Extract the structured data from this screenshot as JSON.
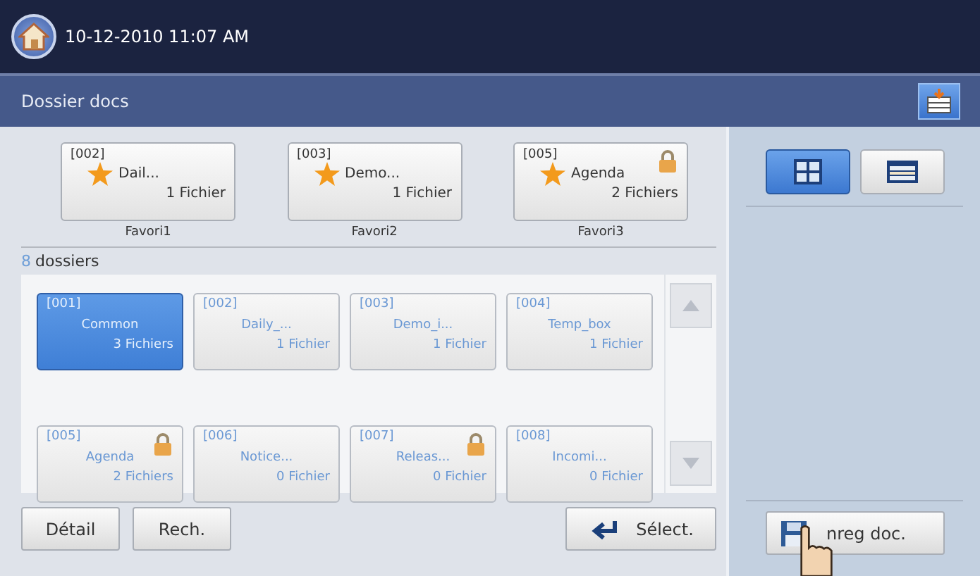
{
  "status_bar": {
    "datetime": "10-12-2010 11:07 AM"
  },
  "title_bar": {
    "title": "Dossier docs"
  },
  "favorites": [
    {
      "number": "[002]",
      "name": "Dail...",
      "count": "1 Fichier",
      "label": "Favori1",
      "locked": false
    },
    {
      "number": "[003]",
      "name": "Demo...",
      "count": "1 Fichier",
      "label": "Favori2",
      "locked": false
    },
    {
      "number": "[005]",
      "name": "Agenda",
      "count": "2 Fichiers",
      "label": "Favori3",
      "locked": true
    }
  ],
  "folder_count": {
    "count": "8",
    "label": "dossiers"
  },
  "folders": [
    {
      "number": "[001]",
      "name": "Common",
      "count": "3 Fichiers",
      "locked": false,
      "selected": true
    },
    {
      "number": "[002]",
      "name": "Daily_...",
      "count": "1 Fichier",
      "locked": false,
      "selected": false
    },
    {
      "number": "[003]",
      "name": "Demo_i...",
      "count": "1 Fichier",
      "locked": false,
      "selected": false
    },
    {
      "number": "[004]",
      "name": "Temp_box",
      "count": "1 Fichier",
      "locked": false,
      "selected": false
    },
    {
      "number": "[005]",
      "name": "Agenda",
      "count": "2 Fichiers",
      "locked": true,
      "selected": false
    },
    {
      "number": "[006]",
      "name": "Notice...",
      "count": "0 Fichier",
      "locked": false,
      "selected": false
    },
    {
      "number": "[007]",
      "name": "Releas...",
      "count": "0 Fichier",
      "locked": true,
      "selected": false
    },
    {
      "number": "[008]",
      "name": "Incomi...",
      "count": "0 Fichier",
      "locked": false,
      "selected": false
    }
  ],
  "actions": [
    {
      "label": "Détail",
      "kind": "plain"
    },
    {
      "label": "Rech.",
      "kind": "plain"
    },
    {
      "label": "Sélect.",
      "kind": "enter"
    }
  ],
  "view_modes": [
    {
      "kind": "grid",
      "selected": true
    },
    {
      "kind": "list",
      "selected": false
    }
  ],
  "save_button": {
    "label": "nreg doc."
  }
}
